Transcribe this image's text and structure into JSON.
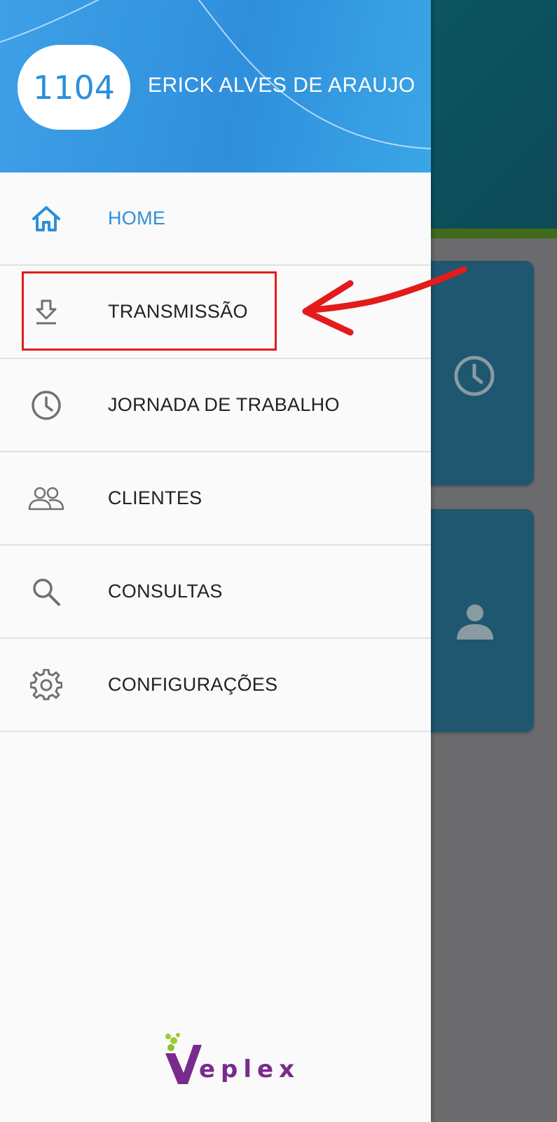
{
  "drawer": {
    "badge_number": "1104",
    "user_name": "ERICK ALVES DE ARAUJO",
    "items": [
      {
        "label": "HOME",
        "icon": "home-icon",
        "active": true
      },
      {
        "label": "TRANSMISSÃO",
        "icon": "download-icon",
        "active": false
      },
      {
        "label": "JORNADA DE TRABALHO",
        "icon": "clock-icon",
        "active": false
      },
      {
        "label": "CLIENTES",
        "icon": "people-icon",
        "active": false
      },
      {
        "label": "CONSULTAS",
        "icon": "search-icon",
        "active": false
      },
      {
        "label": "CONFIGURAÇÕES",
        "icon": "gear-icon",
        "active": false
      }
    ]
  },
  "logo": {
    "text": "eplex",
    "initial": "V"
  },
  "colors": {
    "header_blue": "#3ea0e7",
    "active_blue": "#2b8fdc",
    "annotation_red": "#e31b1b",
    "logo_purple": "#7a2a8c",
    "logo_green": "#9acd32"
  },
  "annotation": {
    "highlighted_item": "TRANSMISSÃO"
  }
}
